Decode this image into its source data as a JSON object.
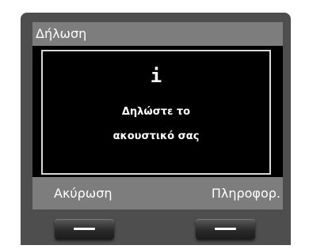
{
  "screen": {
    "title": "Δήλωση",
    "dialog": {
      "icon": "info-icon",
      "icon_glyph": "i",
      "message_line_1": "Δηλώστε το",
      "message_line_2": "ακουστικό σας"
    },
    "softkeys": {
      "left_label": "Ακύρωση",
      "right_label": "Πληροφορ."
    }
  },
  "colors": {
    "bezel": "#4e4e4e",
    "bar": "#7d7d7d",
    "screen": "#000000",
    "text": "#ffffff"
  }
}
